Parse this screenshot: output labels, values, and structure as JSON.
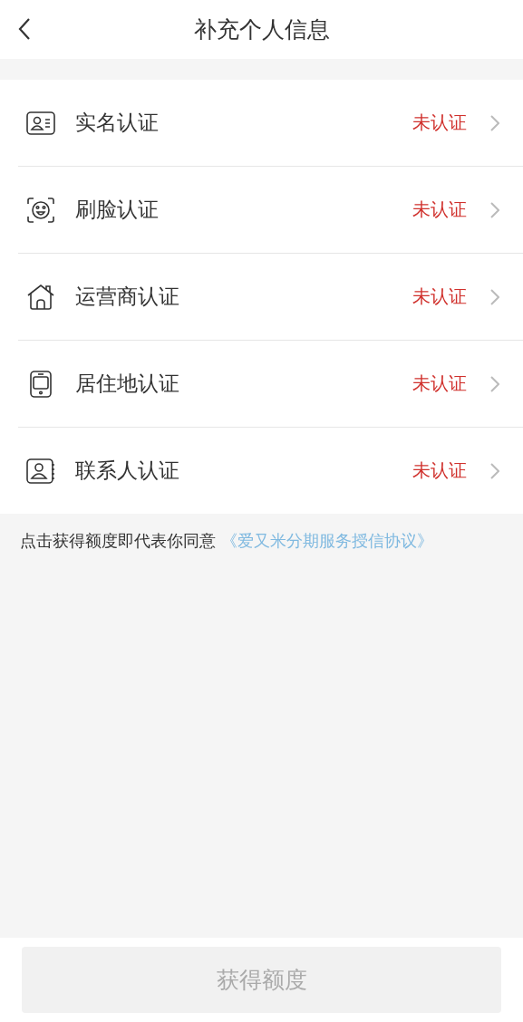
{
  "header": {
    "title": "补充个人信息"
  },
  "items": [
    {
      "kind": "id-card",
      "label": "实名认证",
      "status": "未认证"
    },
    {
      "kind": "face",
      "label": "刷脸认证",
      "status": "未认证"
    },
    {
      "kind": "house",
      "label": "运营商认证",
      "status": "未认证"
    },
    {
      "kind": "phone",
      "label": "居住地认证",
      "status": "未认证"
    },
    {
      "kind": "contact",
      "label": "联系人认证",
      "status": "未认证"
    }
  ],
  "agreement": {
    "text": "点击获得额度即代表你同意",
    "link": "《爱又米分期服务授信协议》"
  },
  "submit": {
    "label": "获得额度",
    "disabled": true
  }
}
